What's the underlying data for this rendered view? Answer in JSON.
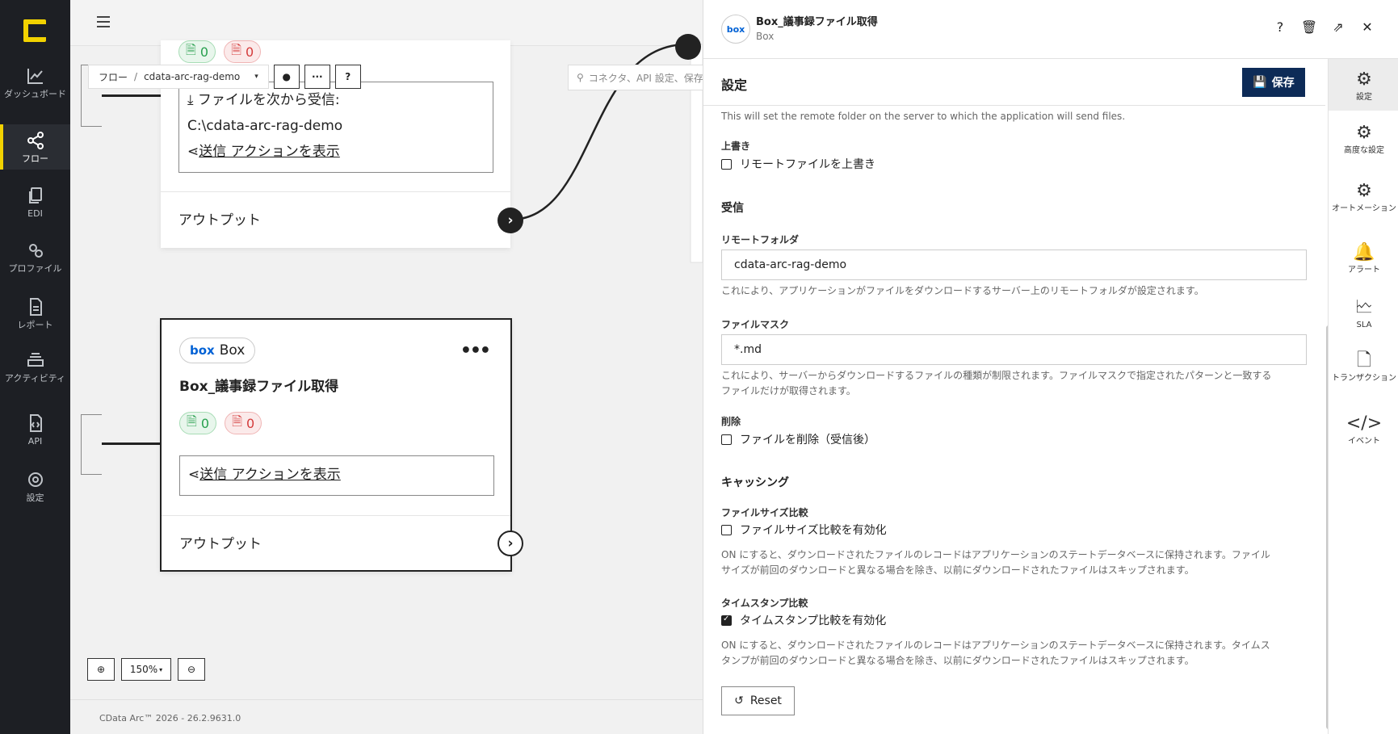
{
  "nav": {
    "items": [
      {
        "label": "ダッシュボード",
        "icon": "chart-icon"
      },
      {
        "label": "フロー",
        "icon": "share-icon"
      },
      {
        "label": "EDI",
        "icon": "documents-icon"
      },
      {
        "label": "プロファイル",
        "icon": "gears-icon"
      },
      {
        "label": "レポート",
        "icon": "report-icon"
      },
      {
        "label": "アクティビティ",
        "icon": "stack-icon"
      },
      {
        "label": "API",
        "icon": "api-file-icon"
      },
      {
        "label": "設定",
        "icon": "gear-icon"
      }
    ]
  },
  "breadcrumb": {
    "root": "フロー",
    "flow": "cdata-arc-rag-demo"
  },
  "search": {
    "placeholder": "コネクタ、API 設定、保存"
  },
  "card1": {
    "ok_count": "0",
    "err_count": "0",
    "receive_label": "ファイルを次から受信:",
    "receive_path": "C:\\cdata-arc-rag-demo",
    "send_link": "送信 アクションを表示",
    "output": "アウトプット"
  },
  "card2": {
    "chip_logo": "box",
    "chip_label": "Box",
    "title": "Box_議事録ファイル取得",
    "ok_count": "0",
    "err_count": "0",
    "send_link": "送信 アクションを表示",
    "output": "アウトプット"
  },
  "zoom": {
    "level": "150%"
  },
  "footer": {
    "text": "CData Arc™ 2026 - 26.2.9631.0"
  },
  "panel": {
    "avatar": "box",
    "title": "Box_議事録ファイル取得",
    "subtitle": "Box",
    "section": "設定",
    "save_label": "保存",
    "top_help": "This will set the remote folder on the server to which the application will send files.",
    "overwrite": {
      "label": "上書き",
      "checkbox": "リモートファイルを上書き"
    },
    "receive_group": "受信",
    "remote_folder": {
      "label": "リモートフォルダ",
      "value": "cdata-arc-rag-demo",
      "help": "これにより、アプリケーションがファイルをダウンロードするサーバー上のリモートフォルダが設定されます。"
    },
    "file_mask": {
      "label": "ファイルマスク",
      "value": "*.md",
      "help1": "これにより、サーバーからダウンロードするファイルの種類が制限されます。ファイルマスクで指定されたパターンと一致する",
      "help2": "ファイルだけが取得されます。"
    },
    "delete": {
      "label": "削除",
      "checkbox": "ファイルを削除（受信後）"
    },
    "caching_group": "キャッシング",
    "size_compare": {
      "label": "ファイルサイズ比較",
      "checkbox": "ファイルサイズ比較を有効化",
      "help1": "ON にすると、ダウンロードされたファイルのレコードはアプリケーションのステートデータベースに保持されます。ファイル",
      "help2": "サイズが前回のダウンロードと異なる場合を除き、以前にダウンロードされたファイルはスキップされます。"
    },
    "timestamp_compare": {
      "label": "タイムスタンプ比較",
      "checkbox": "タイムスタンプ比較を有効化",
      "checked": true,
      "help1": "ON にすると、ダウンロードされたファイルのレコードはアプリケーションのステートデータベースに保持されます。タイムス",
      "help2": "タンプが前回のダウンロードと異なる場合を除き、以前にダウンロードされたファイルはスキップされます。"
    },
    "reset_label": "Reset"
  },
  "rail": {
    "items": [
      {
        "label": "設定"
      },
      {
        "label": "高度な設定"
      },
      {
        "label": "オートメーション"
      },
      {
        "label": "アラート"
      },
      {
        "label": "SLA"
      },
      {
        "label": "トランザクション"
      },
      {
        "label": "イベント"
      }
    ]
  },
  "colors": {
    "accent": "#f2d200",
    "save": "#0d2b57",
    "ok": "#28a04e",
    "err": "#d43c3c",
    "box": "#0061d5"
  }
}
